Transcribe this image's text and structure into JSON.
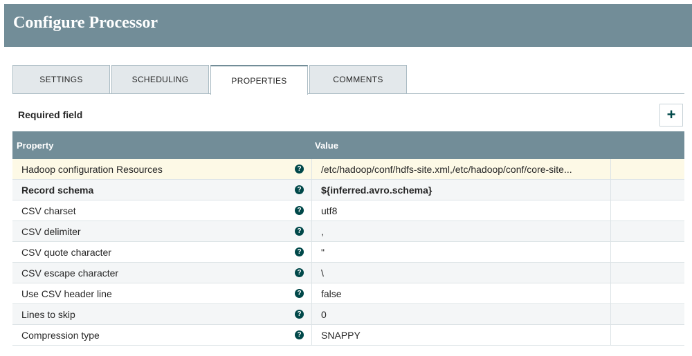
{
  "header": {
    "title": "Configure Processor"
  },
  "tabs": [
    {
      "label": "SETTINGS"
    },
    {
      "label": "SCHEDULING"
    },
    {
      "label": "PROPERTIES"
    },
    {
      "label": "COMMENTS"
    }
  ],
  "active_tab": "PROPERTIES",
  "required_label": "Required field",
  "add_button_icon": "plus-icon",
  "table": {
    "columns": [
      "Property",
      "Value"
    ],
    "rows": [
      {
        "property": "Hadoop configuration Resources",
        "value": "/etc/hadoop/conf/hdfs-site.xml,/etc/hadoop/conf/core-site...",
        "required": false
      },
      {
        "property": "Record schema",
        "value": "${inferred.avro.schema}",
        "required": true
      },
      {
        "property": "CSV charset",
        "value": "utf8",
        "required": false
      },
      {
        "property": "CSV delimiter",
        "value": ",",
        "required": false
      },
      {
        "property": "CSV quote character",
        "value": "\"",
        "required": false
      },
      {
        "property": "CSV escape character",
        "value": "\\",
        "required": false
      },
      {
        "property": "Use CSV header line",
        "value": "false",
        "required": false
      },
      {
        "property": "Lines to skip",
        "value": "0",
        "required": false
      },
      {
        "property": "Compression type",
        "value": "SNAPPY",
        "required": false
      }
    ]
  },
  "colors": {
    "header": "#728d98",
    "accent": "#004849",
    "selected_row": "#fdf9e6"
  }
}
